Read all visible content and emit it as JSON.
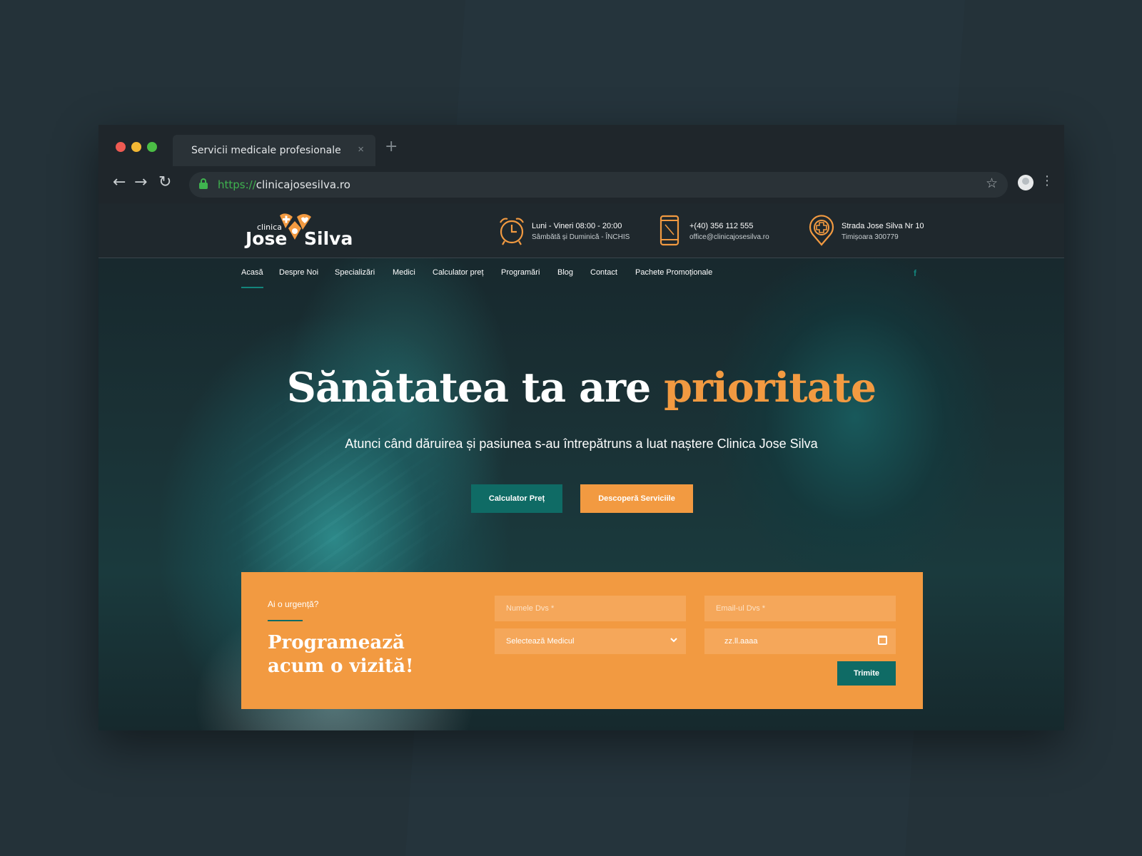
{
  "browser": {
    "tab_title": "Servicii medicale profesionale",
    "tab_close": "×",
    "new_tab": "+",
    "url_protocol": "https://",
    "url_host": "clinicajosesilva.ro"
  },
  "logo": {
    "clinica": "clinica",
    "jose": "Jose",
    "silva": "Silva"
  },
  "contact": {
    "hours_line1": "Luni - Vineri 08:00 - 20:00",
    "hours_line2": "Sâmbătă și Duminică - ÎNCHIS",
    "phone": "+(40) 356 112 555",
    "email": "office@clinicajosesilva.ro",
    "address_line1": "Strada Jose Silva Nr 10",
    "address_line2": "Timișoara 300779"
  },
  "menu": [
    {
      "label": "Acasă"
    },
    {
      "label": "Despre Noi"
    },
    {
      "label": "Specializări"
    },
    {
      "label": "Medici"
    },
    {
      "label": "Calculator preț"
    },
    {
      "label": "Programări"
    },
    {
      "label": "Blog"
    },
    {
      "label": "Contact"
    },
    {
      "label": "Pachete Promoționale"
    }
  ],
  "social": {
    "facebook": "f"
  },
  "hero": {
    "title_main": "Sănătatea ta are ",
    "title_accent": "prioritate",
    "subtitle": "Atunci când dăruirea și pasiunea s-au întrepătruns a luat naștere Clinica Jose Silva",
    "btn_calculator": "Calculator Preț",
    "btn_services": "Descoperă Serviciile"
  },
  "appointment": {
    "eyebrow": "Ai o urgență?",
    "title": "Programează acum o vizită!",
    "name_placeholder": "Numele Dvs *",
    "email_placeholder": "Email-ul Dvs *",
    "medic_select": "Selectează Medicul",
    "date_placeholder": "zz.ll.aaaa",
    "submit": "Trimite"
  },
  "colors": {
    "accent_orange": "#f29a41",
    "accent_teal": "#0f6b65",
    "secure_green": "#3fb34f"
  },
  "icons": {
    "hours": "alarm-clock-icon",
    "phone": "smartphone-icon",
    "address": "map-pin-medical-icon",
    "calendar": "calendar-icon",
    "select": "chevron-down-icon"
  }
}
